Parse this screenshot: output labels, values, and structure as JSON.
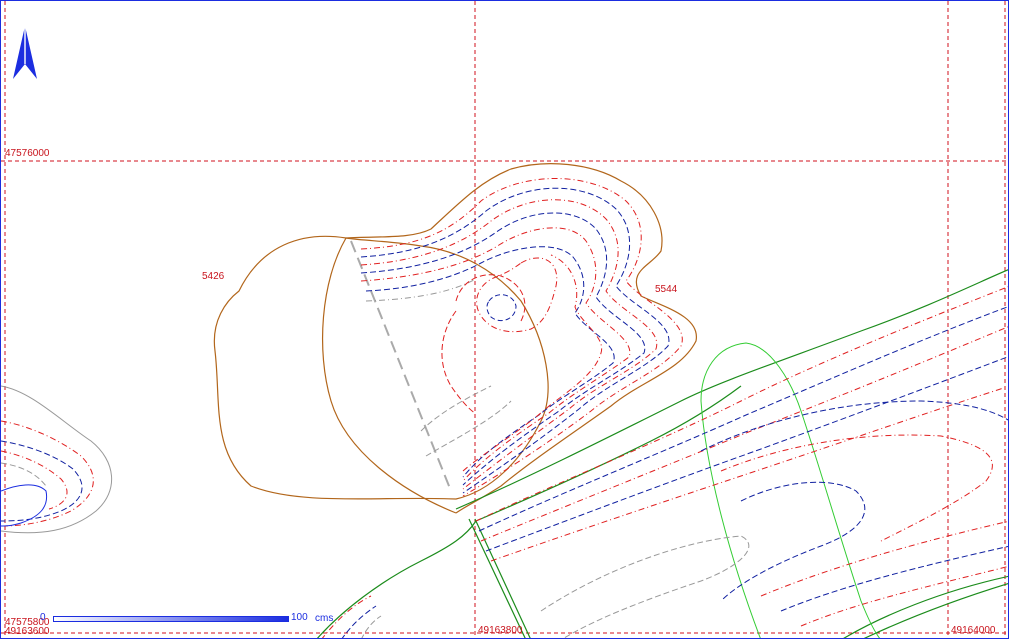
{
  "map": {
    "border_color": "#1b2de0",
    "grid_color": "#d0121c",
    "grid_labels": {
      "northing_top": "47576000",
      "northing_bottom": "47575800",
      "easting_left": "49163600",
      "easting_mid": "49163800",
      "easting_right": "49164000"
    },
    "parcels": [
      {
        "id": "5426"
      },
      {
        "id": "5544"
      }
    ],
    "scale": {
      "zero": "0",
      "max": "100",
      "unit": "cms"
    },
    "north_arrow": "north-arrow-icon",
    "colors": {
      "parcel_outline": "#b2661b",
      "contour_red": "#e02020",
      "contour_blue": "#1020a0",
      "contour_gray": "#999999",
      "road_green": "#1c8c1c",
      "field_green": "#33cc33",
      "text_red": "#c8131c",
      "text_blue": "#1b2de0"
    }
  }
}
